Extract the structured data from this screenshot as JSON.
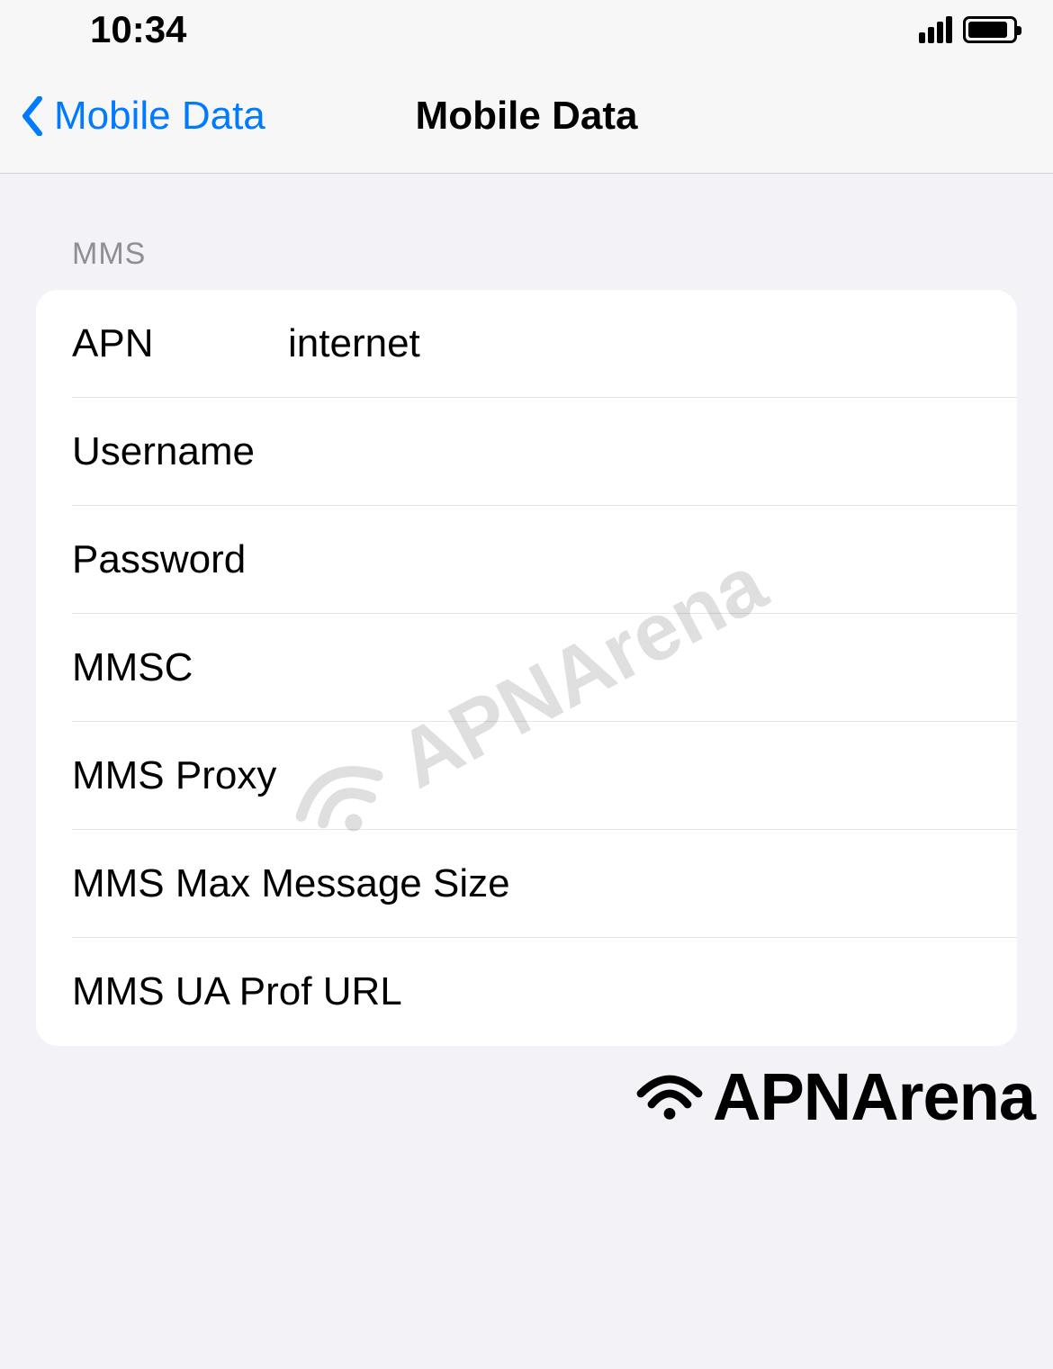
{
  "status": {
    "time": "10:34"
  },
  "nav": {
    "back_label": "Mobile Data",
    "title": "Mobile Data"
  },
  "section": {
    "header": "MMS",
    "rows": [
      {
        "label": "APN",
        "value": "internet",
        "wide": false
      },
      {
        "label": "Username",
        "value": "",
        "wide": false
      },
      {
        "label": "Password",
        "value": "",
        "wide": false
      },
      {
        "label": "MMSC",
        "value": "",
        "wide": false
      },
      {
        "label": "MMS Proxy",
        "value": "",
        "wide": false
      },
      {
        "label": "MMS Max Message Size",
        "value": "",
        "wide": true
      },
      {
        "label": "MMS UA Prof URL",
        "value": "",
        "wide": true
      }
    ]
  },
  "watermark": {
    "text": "APNArena"
  },
  "brand": {
    "text": "APNArena"
  }
}
